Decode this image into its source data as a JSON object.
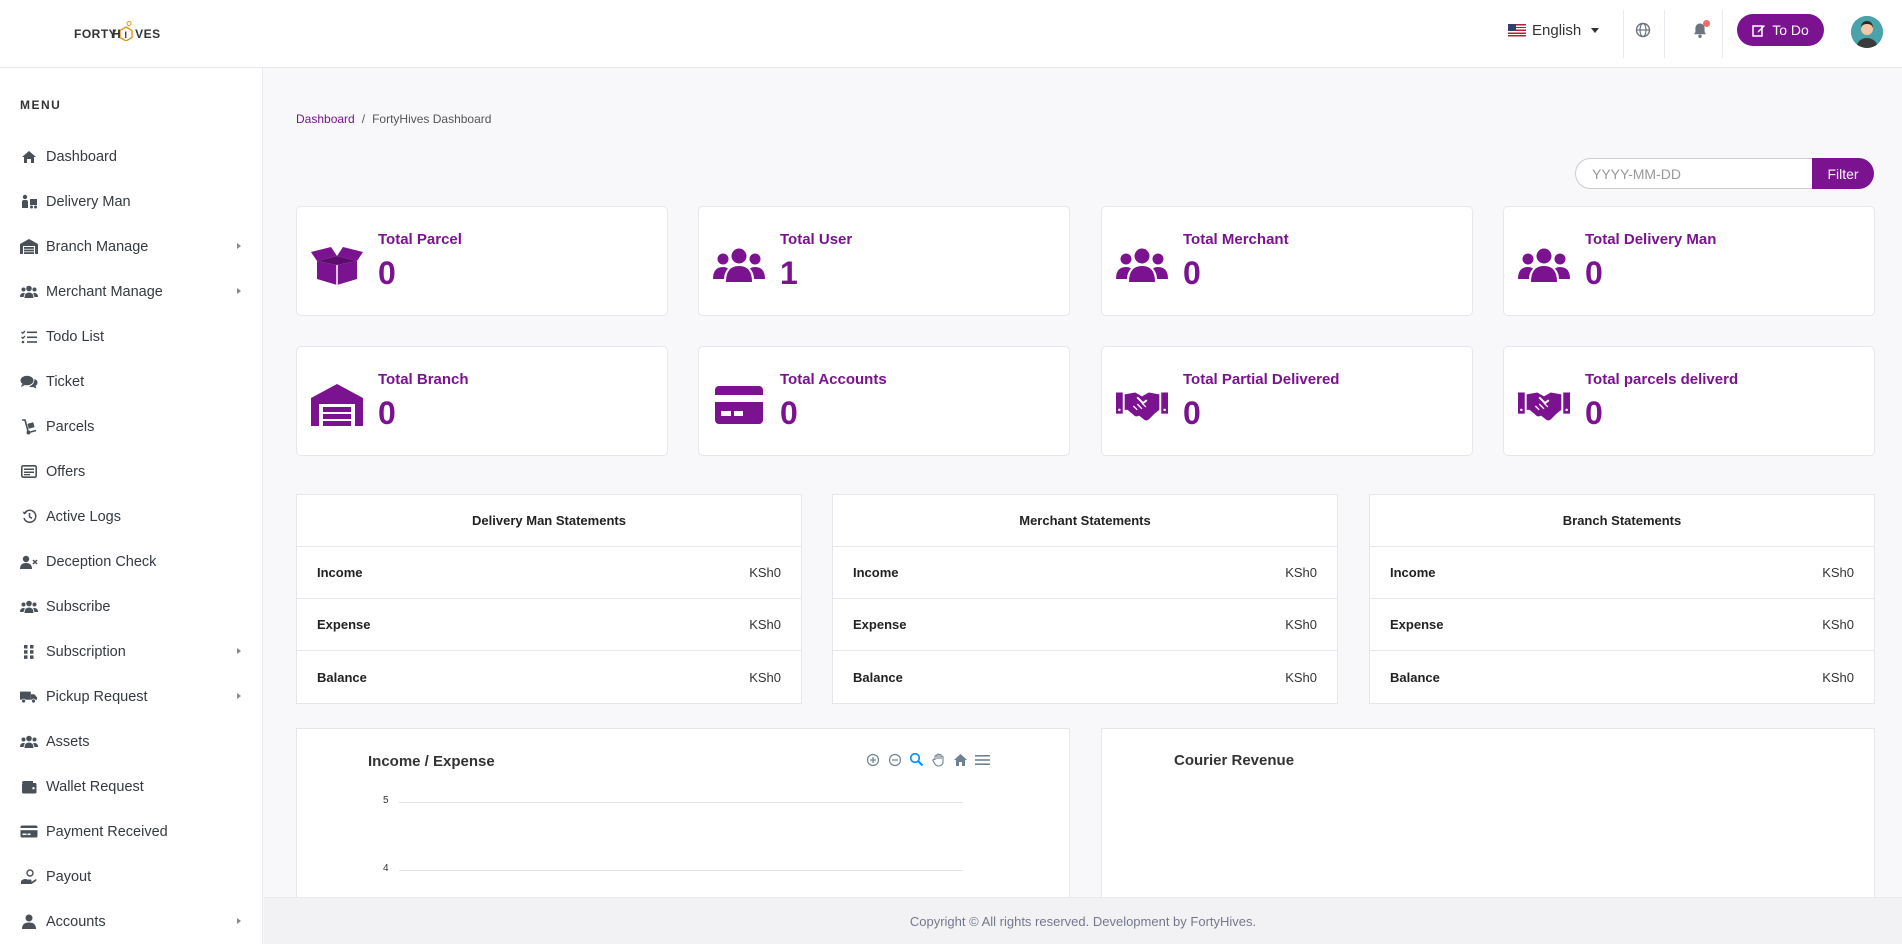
{
  "header": {
    "logo_left": "FORTY",
    "logo_h": "H",
    "logo_right": "VES",
    "language": "English",
    "todo_label": "To Do"
  },
  "sidebar": {
    "menu_title": "MENU",
    "items": [
      {
        "label": "Dashboard",
        "icon": "home-icon",
        "has_arrow": false
      },
      {
        "label": "Delivery Man",
        "icon": "delivery-man-icon",
        "has_arrow": false
      },
      {
        "label": "Branch Manage",
        "icon": "warehouse-icon",
        "has_arrow": true
      },
      {
        "label": "Merchant Manage",
        "icon": "users-icon",
        "has_arrow": true
      },
      {
        "label": "Todo List",
        "icon": "list-check-icon",
        "has_arrow": false
      },
      {
        "label": "Ticket",
        "icon": "comments-icon",
        "has_arrow": false
      },
      {
        "label": "Parcels",
        "icon": "dolly-icon",
        "has_arrow": false
      },
      {
        "label": "Offers",
        "icon": "offer-icon",
        "has_arrow": false
      },
      {
        "label": "Active Logs",
        "icon": "history-icon",
        "has_arrow": false
      },
      {
        "label": "Deception Check",
        "icon": "user-x-icon",
        "has_arrow": false
      },
      {
        "label": "Subscribe",
        "icon": "users-icon",
        "has_arrow": false
      },
      {
        "label": "Subscription",
        "icon": "grip-icon",
        "has_arrow": true
      },
      {
        "label": "Pickup Request",
        "icon": "truck-icon",
        "has_arrow": true
      },
      {
        "label": "Assets",
        "icon": "users-icon",
        "has_arrow": false
      },
      {
        "label": "Wallet Request",
        "icon": "wallet-icon",
        "has_arrow": false
      },
      {
        "label": "Payment Received",
        "icon": "credit-card-icon",
        "has_arrow": false
      },
      {
        "label": "Payout",
        "icon": "hand-coin-icon",
        "has_arrow": false
      },
      {
        "label": "Accounts",
        "icon": "user-icon",
        "has_arrow": true
      }
    ]
  },
  "breadcrumb": {
    "link": "Dashboard",
    "separator": "/",
    "current": "FortyHives Dashboard"
  },
  "filter": {
    "placeholder": "YYYY-MM-DD",
    "button": "Filter"
  },
  "stats": [
    {
      "label": "Total Parcel",
      "value": "0",
      "icon": "box-open-icon"
    },
    {
      "label": "Total User",
      "value": "1",
      "icon": "users-icon"
    },
    {
      "label": "Total Merchant",
      "value": "0",
      "icon": "users-icon"
    },
    {
      "label": "Total Delivery Man",
      "value": "0",
      "icon": "users-icon"
    },
    {
      "label": "Total Branch",
      "value": "0",
      "icon": "warehouse-icon"
    },
    {
      "label": "Total Accounts",
      "value": "0",
      "icon": "credit-card-icon"
    },
    {
      "label": "Total Partial Delivered",
      "value": "0",
      "icon": "handshake-icon"
    },
    {
      "label": "Total parcels deliverd",
      "value": "0",
      "icon": "handshake-icon"
    }
  ],
  "statements": [
    {
      "title": "Delivery Man Statements",
      "rows": [
        {
          "label": "Income",
          "value": "KSh0"
        },
        {
          "label": "Expense",
          "value": "KSh0"
        },
        {
          "label": "Balance",
          "value": "KSh0"
        }
      ]
    },
    {
      "title": "Merchant Statements",
      "rows": [
        {
          "label": "Income",
          "value": "KSh0"
        },
        {
          "label": "Expense",
          "value": "KSh0"
        },
        {
          "label": "Balance",
          "value": "KSh0"
        }
      ]
    },
    {
      "title": "Branch Statements",
      "rows": [
        {
          "label": "Income",
          "value": "KSh0"
        },
        {
          "label": "Expense",
          "value": "KSh0"
        },
        {
          "label": "Balance",
          "value": "KSh0"
        }
      ]
    }
  ],
  "charts": {
    "income_expense": {
      "title": "Income / Expense",
      "y_ticks": [
        "5",
        "4"
      ]
    },
    "courier_revenue": {
      "title": "Courier Revenue"
    }
  },
  "footer": {
    "text": "Copyright © All rights reserved. Development by FortyHives."
  },
  "colors": {
    "accent": "#7b1290"
  }
}
